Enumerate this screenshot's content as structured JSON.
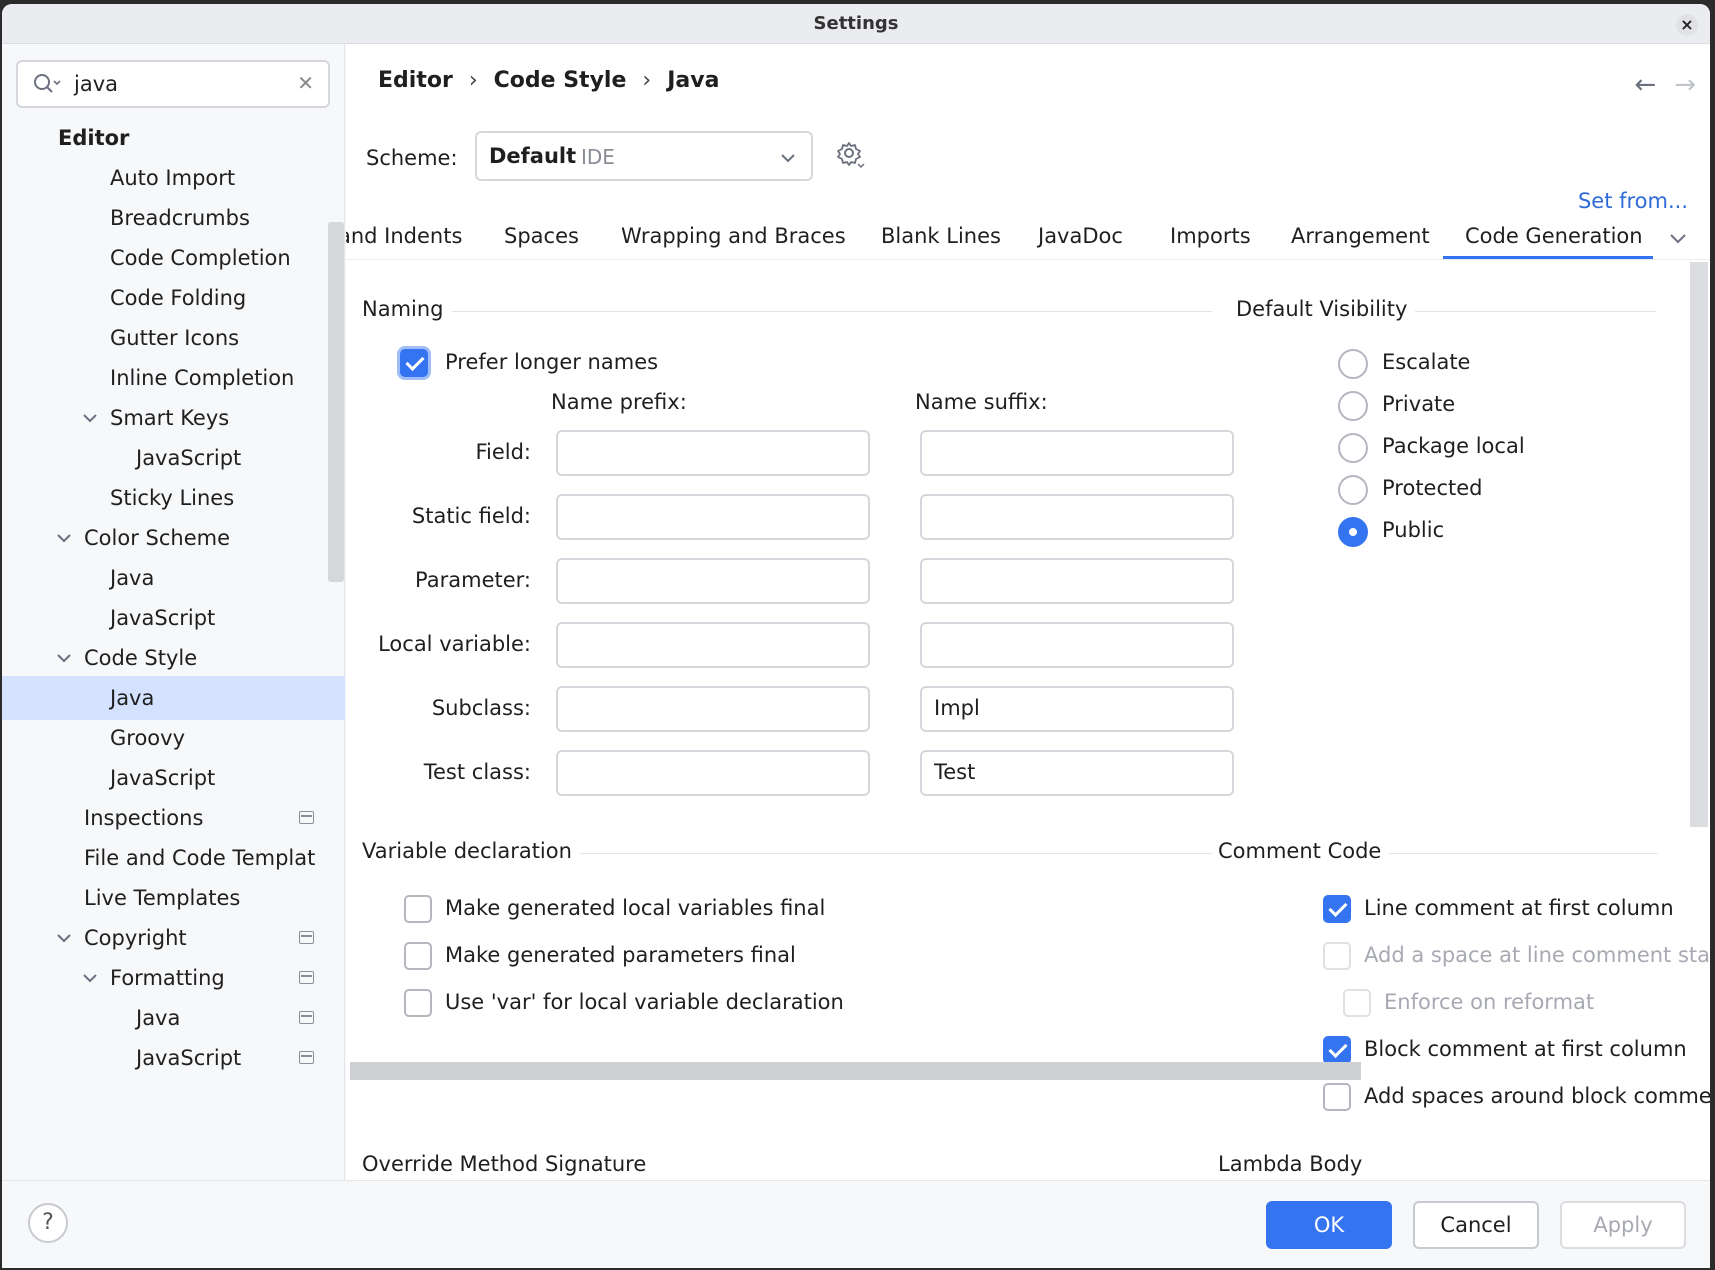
{
  "window": {
    "title": "Settings"
  },
  "search": {
    "value": "java"
  },
  "tree": [
    {
      "label": "Editor"
    },
    {
      "label": "Auto Import"
    },
    {
      "label": "Breadcrumbs"
    },
    {
      "label": "Code Completion"
    },
    {
      "label": "Code Folding"
    },
    {
      "label": "Gutter Icons"
    },
    {
      "label": "Inline Completion"
    },
    {
      "label": "Smart Keys"
    },
    {
      "label": "JavaScript"
    },
    {
      "label": "Sticky Lines"
    },
    {
      "label": "Color Scheme"
    },
    {
      "label": "Java"
    },
    {
      "label": "JavaScript"
    },
    {
      "label": "Code Style"
    },
    {
      "label": "Java"
    },
    {
      "label": "Groovy"
    },
    {
      "label": "JavaScript"
    },
    {
      "label": "Inspections"
    },
    {
      "label": "File and Code Templat"
    },
    {
      "label": "Live Templates"
    },
    {
      "label": "Copyright"
    },
    {
      "label": "Formatting"
    },
    {
      "label": "Java"
    },
    {
      "label": "JavaScript"
    }
  ],
  "breadcrumb": [
    "Editor",
    "Code Style",
    "Java"
  ],
  "scheme": {
    "label": "Scheme:",
    "value": "Default",
    "sub": "IDE"
  },
  "set_from": "Set from...",
  "tabs": [
    "and Indents",
    "Spaces",
    "Wrapping and Braces",
    "Blank Lines",
    "JavaDoc",
    "Imports",
    "Arrangement",
    "Code Generation"
  ],
  "active_tab": "Code Generation",
  "naming": {
    "title": "Naming",
    "prefer_longer": {
      "label": "Prefer longer names",
      "checked": true
    },
    "prefix_header": "Name prefix:",
    "suffix_header": "Name suffix:",
    "rows": [
      {
        "label": "Field:",
        "prefix": "",
        "suffix": ""
      },
      {
        "label": "Static field:",
        "prefix": "",
        "suffix": ""
      },
      {
        "label": "Parameter:",
        "prefix": "",
        "suffix": ""
      },
      {
        "label": "Local variable:",
        "prefix": "",
        "suffix": ""
      },
      {
        "label": "Subclass:",
        "prefix": "",
        "suffix": "Impl"
      },
      {
        "label": "Test class:",
        "prefix": "",
        "suffix": "Test"
      }
    ]
  },
  "visibility": {
    "title": "Default Visibility",
    "options": [
      "Escalate",
      "Private",
      "Package local",
      "Protected",
      "Public"
    ],
    "selected": "Public"
  },
  "variable_declaration": {
    "title": "Variable declaration",
    "options": [
      {
        "label": "Make generated local variables final",
        "checked": false
      },
      {
        "label": "Make generated parameters final",
        "checked": false
      },
      {
        "label": "Use 'var' for local variable declaration",
        "checked": false
      }
    ]
  },
  "comment_code": {
    "title": "Comment Code",
    "options": [
      {
        "label": "Line comment at first column",
        "checked": true,
        "disabled": false
      },
      {
        "label": "Add a space at line comment start",
        "checked": false,
        "disabled": true
      },
      {
        "label": "Enforce on reformat",
        "checked": false,
        "disabled": true
      },
      {
        "label": "Block comment at first column",
        "checked": true,
        "disabled": false
      },
      {
        "label": "Add spaces around block commen",
        "checked": false,
        "disabled": false
      }
    ]
  },
  "bottom_sections": {
    "override": "Override Method Signature",
    "lambda": "Lambda Body"
  },
  "footer": {
    "help": "?",
    "ok": "OK",
    "cancel": "Cancel",
    "apply": "Apply"
  },
  "colors": {
    "accent": "#3574f0",
    "selection": "#d4e2ff",
    "link": "#2f6bd8"
  }
}
